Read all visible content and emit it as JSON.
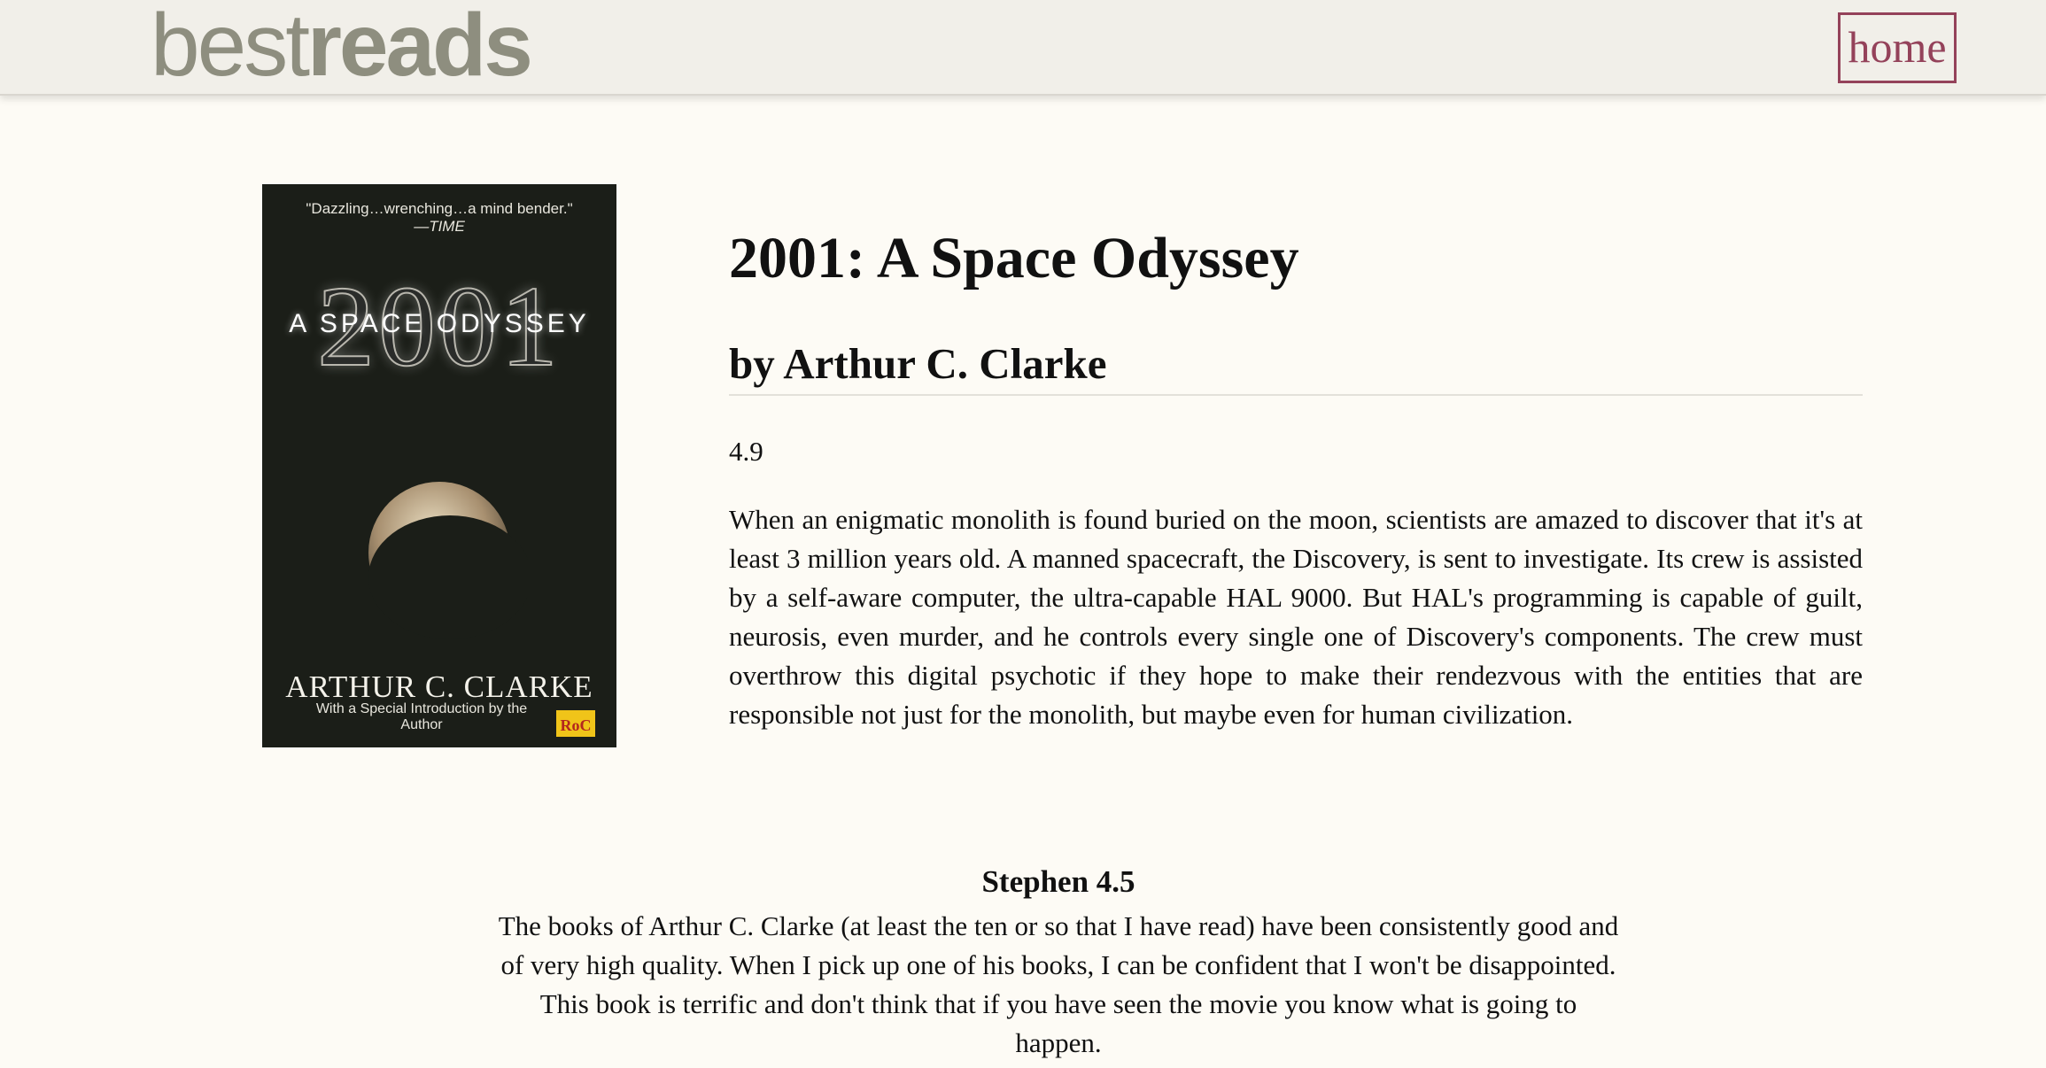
{
  "header": {
    "logo_light": "best",
    "logo_bold": "reads",
    "home_label": "home"
  },
  "cover": {
    "quote": "\"Dazzling…wrenching…a mind bender.\"",
    "quote_source": "—TIME",
    "big_number": "2001",
    "subtitle": "A SPACE ODYSSEY",
    "author": "ARTHUR C. CLARKE",
    "intro": "With a Special Introduction by the Author",
    "publisher_mark": "RoC"
  },
  "book": {
    "title": "2001: A Space Odyssey",
    "author_line": "by Arthur C. Clarke",
    "rating": "4.9",
    "description": "When an enigmatic monolith is found buried on the moon, scientists are amazed to discover that it's at least 3 million years old. A manned spacecraft, the Discovery, is sent to investigate. Its crew is assisted by a self-aware computer, the ultra-capable HAL 9000. But HAL's programming is capable of guilt, neurosis, even murder, and he controls every single one of Discovery's components. The crew must overthrow this digital psychotic if they hope to make their rendezvous with the entities that are responsible not just for the monolith, but maybe even for human civilization."
  },
  "reviews": [
    {
      "name": "Stephen",
      "score": "4.5",
      "text": "The books of Arthur C. Clarke (at least the ten or so that I have read) have been consistently good and of very high quality. When I pick up one of his books, I can be confident that I won't be disappointed. This book is terrific and don't think that if you have seen the movie you know what is going to happen."
    }
  ]
}
